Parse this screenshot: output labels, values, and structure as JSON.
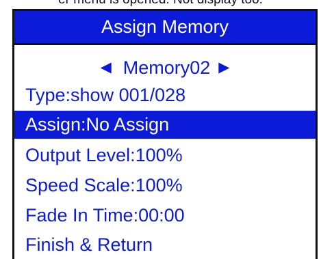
{
  "caption": "er menu is opened. Not display too.",
  "screen": {
    "title": "Assign Memory",
    "memory": {
      "prev_icon": "triangle-left",
      "name": "Memory02",
      "next_icon": "triangle-right"
    },
    "items": [
      {
        "label": "Type:show 001/028",
        "selected": false
      },
      {
        "label": "Assign:No Assign",
        "selected": true
      },
      {
        "label": "Output Level:100%",
        "selected": false
      },
      {
        "label": "Speed Scale:100%",
        "selected": false
      },
      {
        "label": "Fade In Time:00:00",
        "selected": false
      },
      {
        "label": "Finish & Return",
        "selected": false
      }
    ]
  },
  "colors": {
    "accent": "#0b1bd8",
    "highlight_text": "#ffffff",
    "frame": "#111111"
  }
}
